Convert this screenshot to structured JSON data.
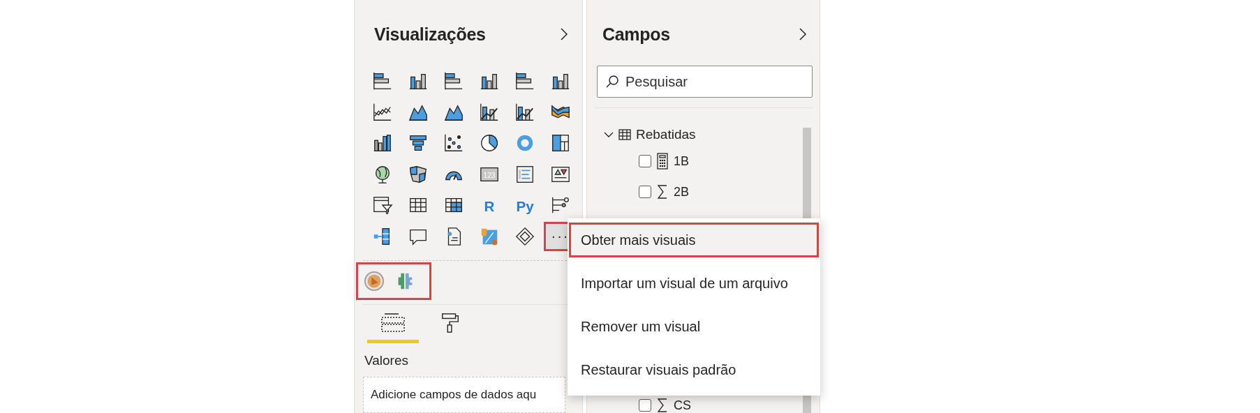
{
  "visualizations": {
    "title": "Visualizações",
    "icons": [
      {
        "kind": "hbar"
      },
      {
        "kind": "vbar"
      },
      {
        "kind": "hbar"
      },
      {
        "kind": "vbar"
      },
      {
        "kind": "hbar"
      },
      {
        "kind": "vbar"
      },
      {
        "kind": "line"
      },
      {
        "kind": "area"
      },
      {
        "kind": "area"
      },
      {
        "kind": "combo"
      },
      {
        "kind": "combo"
      },
      {
        "kind": "ribbon"
      },
      {
        "kind": "waterfall"
      },
      {
        "kind": "funnel"
      },
      {
        "kind": "scatter"
      },
      {
        "kind": "pie"
      },
      {
        "kind": "donut"
      },
      {
        "kind": "treemap"
      },
      {
        "kind": "globe"
      },
      {
        "kind": "filled-map"
      },
      {
        "kind": "gauge"
      },
      {
        "kind": "card",
        "label": "123"
      },
      {
        "kind": "multirow-card"
      },
      {
        "kind": "kpi"
      },
      {
        "kind": "slicer"
      },
      {
        "kind": "table"
      },
      {
        "kind": "matrix"
      },
      {
        "kind": "script",
        "label": "R"
      },
      {
        "kind": "script",
        "label": "Py"
      },
      {
        "kind": "influencers"
      },
      {
        "kind": "decomposition"
      },
      {
        "kind": "qa"
      },
      {
        "kind": "paginated"
      },
      {
        "kind": "apps"
      },
      {
        "kind": "diamond"
      }
    ],
    "more_button": {
      "label": "···",
      "highlighted": true
    },
    "custom_visuals": {
      "highlighted": true,
      "icons": [
        {
          "kind": "orange-circle"
        },
        {
          "kind": "puzzle"
        }
      ]
    },
    "tabs": [
      {
        "kind": "fields",
        "selected": true
      },
      {
        "kind": "format",
        "selected": false
      }
    ],
    "well": {
      "label": "Valores",
      "placeholder": "Adicione campos de dados aqu"
    }
  },
  "fields": {
    "title": "Campos",
    "search": {
      "placeholder": "Pesquisar"
    },
    "tables": [
      {
        "name": "Rebatidas",
        "expanded": true,
        "children": [
          {
            "name": "1B",
            "kind": "calc",
            "checked": false
          },
          {
            "name": "2B",
            "kind": "sum",
            "checked": false
          }
        ]
      }
    ],
    "bottom_field": {
      "name": "CS",
      "kind": "sum",
      "checked": false
    }
  },
  "menu": {
    "items": [
      {
        "label": "Obter mais visuais",
        "highlighted": true
      },
      {
        "label": "Importar um visual de um arquivo",
        "highlighted": false
      },
      {
        "label": "Remover um visual",
        "highlighted": false
      },
      {
        "label": "Restaurar visuais padrão",
        "highlighted": false
      }
    ]
  }
}
